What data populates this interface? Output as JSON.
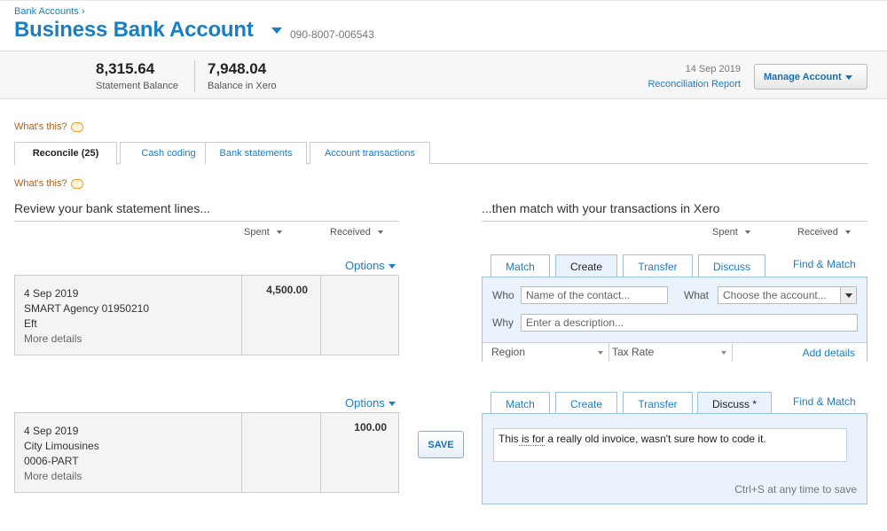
{
  "header": {
    "breadcrumb": "Bank Accounts ›",
    "title": "Business Bank Account",
    "account_number": "090-8007-006543"
  },
  "balances": {
    "statement_value": "8,315.64",
    "statement_label": "Statement Balance",
    "xero_value": "7,948.04",
    "xero_label": "Balance in Xero",
    "reconciliation_date": "14 Sep 2019",
    "reconciliation_link": "Reconciliation Report",
    "manage_button": "Manage Account"
  },
  "whats_this": "What's this?",
  "main_tabs": [
    {
      "label": "Reconcile (25)",
      "active": true
    },
    {
      "label": "Cash coding"
    },
    {
      "label": "Bank statements"
    },
    {
      "label": "Account transactions"
    }
  ],
  "left": {
    "heading": "Review your bank statement lines...",
    "col_spent": "Spent",
    "col_received": "Received",
    "options_label": "Options"
  },
  "right": {
    "heading": "...then match with your transactions in Xero",
    "col_spent": "Spent",
    "col_received": "Received",
    "find_match": "Find & Match"
  },
  "lines": [
    {
      "date": "4 Sep 2019",
      "payee": "SMART Agency 01950210",
      "reference": "Eft",
      "more": "More details",
      "spent": "4,500.00",
      "received": "",
      "tabs": [
        "Match",
        "Create",
        "Transfer",
        "Discuss"
      ],
      "active_tab": "Create",
      "create": {
        "who_label": "Who",
        "who_placeholder": "Name of the contact...",
        "what_label": "What",
        "what_placeholder": "Choose the account...",
        "why_label": "Why",
        "why_placeholder": "Enter a description...",
        "region": "Region",
        "tax_rate": "Tax Rate",
        "add_details": "Add details"
      }
    },
    {
      "date": "4 Sep 2019",
      "payee": "City Limousines",
      "reference": "0006-PART",
      "more": "More details",
      "spent": "",
      "received": "100.00",
      "tabs": [
        "Match",
        "Create",
        "Transfer",
        "Discuss *"
      ],
      "active_tab": "Discuss *",
      "save_button": "SAVE",
      "discuss": {
        "text_start": "This",
        "text_spell": " is for",
        "text_rest": " a really old invoice, wasn't sure how to code it.",
        "hint": "Ctrl+S at any time to save"
      }
    }
  ],
  "colors": {
    "accent": "#1a7ec4",
    "panel_bg": "#eaf2fb",
    "panel_border": "#9ec3e0"
  }
}
